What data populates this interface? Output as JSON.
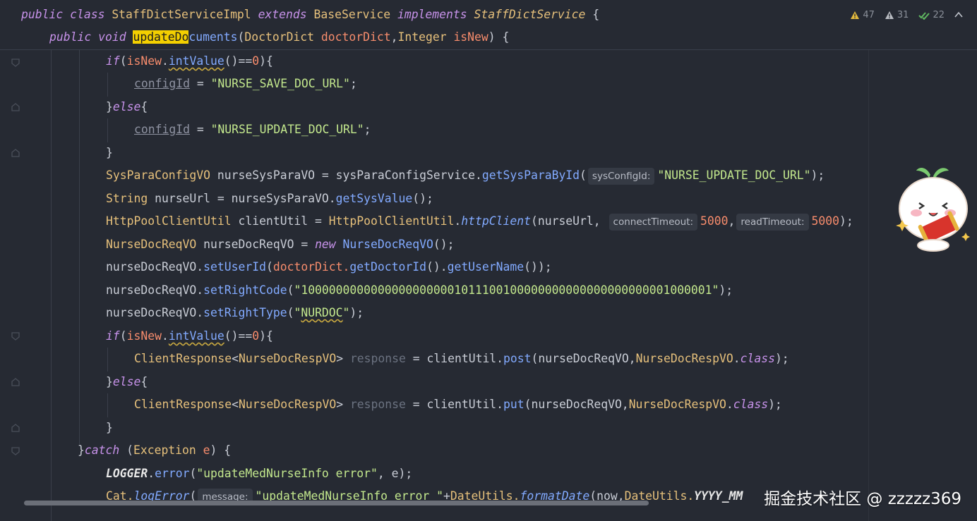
{
  "colors": {
    "background": "#262a33",
    "keyword": "#c792ea",
    "type": "#e6c07b",
    "method": "#82aaff",
    "string": "#c3e88d",
    "number": "#f78c6c",
    "highlight": "#f4d000"
  },
  "inspections": {
    "warnings": "47",
    "weak_warnings": "31",
    "typos": "22"
  },
  "sticky": {
    "line1": {
      "public": "public",
      "class": "class",
      "name": "StaffDictServiceImpl",
      "extends": "extends",
      "base": "BaseService",
      "implements": "implements",
      "iface": "StaffDictService",
      "brace": " {"
    },
    "line2": {
      "public": "public",
      "void": "void",
      "hl": "updateDo",
      "rest": "cuments",
      "p1type": "DoctorDict",
      "p1name": "doctorDict",
      "comma": ",",
      "p2type": "Integer",
      "p2name": "isNew",
      "end": ") {"
    }
  },
  "code": {
    "l1": {
      "if": "if",
      "var": "isNew",
      "m": "intValue",
      "rest": "()==",
      "num": "0",
      "end": "){"
    },
    "l2": {
      "field": "configId",
      "eq": " = ",
      "str": "\"NURSE_SAVE_DOC_URL\"",
      "end": ";"
    },
    "l3": {
      "brace": "}",
      "else": "else",
      "end": "{"
    },
    "l4": {
      "field": "configId",
      "eq": " = ",
      "str": "\"NURSE_UPDATE_DOC_URL\"",
      "end": ";"
    },
    "l5": {
      "brace": "}"
    },
    "l6": {
      "type": "SysParaConfigVO",
      "var": " nurseSysParaVO = sysParaConfigService.",
      "m": "getSysParaById",
      "open": "(",
      "hint": "sysConfigId:",
      "str": "\"NURSE_UPDATE_DOC_URL\"",
      "end": ");"
    },
    "l7": {
      "type": "String",
      "var": " nurseUrl = nurseSysParaVO.",
      "m": "getSysValue",
      "end": "();"
    },
    "l8": {
      "type": "HttpPoolClientUtil",
      "var": " clientUtil = ",
      "type2": "HttpPoolClientUtil",
      "dot": ".",
      "m": "httpClient",
      "open": "(nurseUrl, ",
      "hint1": "connectTimeout:",
      "n1": "5000",
      "comma": ",",
      "hint2": "readTimeout:",
      "n2": "5000",
      "end": ");"
    },
    "l9": {
      "type": "NurseDocReqVO",
      "var": " nurseDocReqVO = ",
      "new": "new",
      "type2": "NurseDocReqVO",
      "end": "();"
    },
    "l10": {
      "var": "nurseDocReqVO.",
      "m": "setUserId",
      "open": "(",
      "arg": "doctorDict.",
      "m2": "getDoctorId",
      "mid": "().",
      "m3": "getUserName",
      "end": "());"
    },
    "l11": {
      "var": "nurseDocReqVO.",
      "m": "setRightCode",
      "open": "(",
      "str": "\"10000000000000000000001011100100000000000000000000001000001\"",
      "end": ");"
    },
    "l12": {
      "var": "nurseDocReqVO.",
      "m": "setRightType",
      "open": "(",
      "q1": "\"",
      "sq": "NURDOC",
      "q2": "\"",
      "end": ");"
    },
    "l13": {
      "if": "if",
      "var": "isNew",
      "m": "intValue",
      "rest": "()==",
      "num": "0",
      "end": "){"
    },
    "l14": {
      "type": "ClientResponse",
      "lt": "<",
      "type2": "NurseDocRespVO",
      "gt": ">",
      "unused": "response",
      "eq": " = clientUtil.",
      "m": "post",
      "open": "(nurseDocReqVO,",
      "type3": "NurseDocRespVO",
      "dot": ".",
      "cls": "class",
      "end": ");"
    },
    "l15": {
      "brace": "}",
      "else": "else",
      "end": "{"
    },
    "l16": {
      "type": "ClientResponse",
      "lt": "<",
      "type2": "NurseDocRespVO",
      "gt": ">",
      "unused": "response",
      "eq": " = clientUtil.",
      "m": "put",
      "open": "(nurseDocReqVO,",
      "type3": "NurseDocRespVO",
      "dot": ".",
      "cls": "class",
      "end": ");"
    },
    "l17": {
      "brace": "}"
    },
    "l18": {
      "brace": "}",
      "catch": "catch",
      "open": " (",
      "type": "Exception",
      "sp": " ",
      "pm": "e",
      "end": ") {"
    },
    "l19": {
      "logger": "LOGGER",
      "dot": ".",
      "m": "error",
      "open": "(",
      "str": "\"updateMedNurseInfo error\"",
      "rest": ", e);"
    },
    "l20": {
      "cat": "Cat.",
      "m": "logError",
      "open": "(",
      "hint": "message:",
      "str": "\"updateMedNurseInfo error \"",
      "plus": "+",
      "du": "DateUtils.",
      "m2": "formatDate",
      "args": "(now,",
      "du2": "DateUtils.",
      "const": "YYYY_MM"
    }
  },
  "watermark": "掘金技术社区 @ zzzzz369"
}
